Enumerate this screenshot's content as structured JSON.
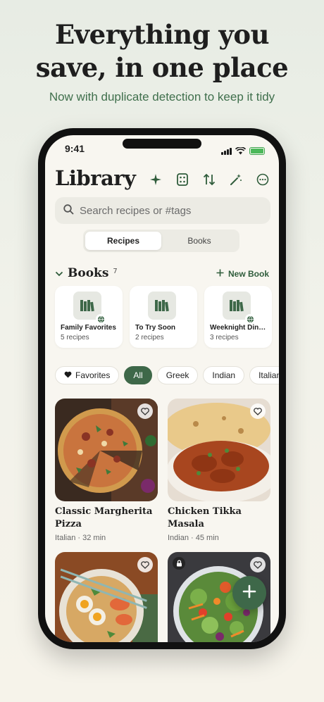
{
  "marketing": {
    "headline_line1": "Everything you",
    "headline_line2": "save, in one place",
    "subhead": "Now with duplicate detection to keep it tidy"
  },
  "status_bar": {
    "time": "9:41"
  },
  "header": {
    "title": "Library",
    "icons": [
      "sparkle-icon",
      "dice-icon",
      "sort-icon",
      "magic-wand-icon",
      "more-icon"
    ]
  },
  "search": {
    "placeholder": "Search recipes or #tags"
  },
  "segments": [
    {
      "label": "Recipes",
      "active": true
    },
    {
      "label": "Books",
      "active": false
    }
  ],
  "books": {
    "title": "Books",
    "count": "7",
    "new_label": "New Book",
    "items": [
      {
        "name": "Family Favorites",
        "count": "5 recipes"
      },
      {
        "name": "To Try Soon",
        "count": "2 recipes"
      },
      {
        "name": "Weeknight Din…",
        "count": "3 recipes"
      }
    ]
  },
  "chips": [
    "Favorites",
    "All",
    "Greek",
    "Indian",
    "Italian"
  ],
  "active_chip": "All",
  "recipes": [
    {
      "title": "Classic Margherita Pizza",
      "meta": "Italian · 32 min"
    },
    {
      "title": "Chicken Tikka Masala",
      "meta": "Indian · 45 min"
    },
    {
      "title": "",
      "meta": ""
    },
    {
      "title": "",
      "meta": ""
    }
  ],
  "colors": {
    "accent": "#3e6849",
    "subhead": "#3f6f4c"
  }
}
